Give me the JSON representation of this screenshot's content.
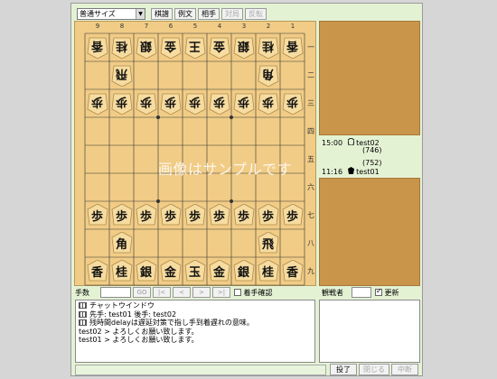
{
  "toolbar": {
    "size_select": "普通サイズ",
    "buttons": [
      {
        "label": "棋譜",
        "disabled": false
      },
      {
        "label": "例文",
        "disabled": false
      },
      {
        "label": "相手",
        "disabled": false
      },
      {
        "label": "対局",
        "disabled": true
      },
      {
        "label": "反転",
        "disabled": true
      }
    ]
  },
  "board": {
    "col_labels": [
      "9",
      "8",
      "7",
      "6",
      "5",
      "4",
      "3",
      "2",
      "1"
    ],
    "row_labels": [
      "一",
      "二",
      "三",
      "四",
      "五",
      "六",
      "七",
      "八",
      "九"
    ],
    "pieces": [
      {
        "r": 0,
        "c": 0,
        "k": "香",
        "gote": true
      },
      {
        "r": 0,
        "c": 1,
        "k": "桂",
        "gote": true
      },
      {
        "r": 0,
        "c": 2,
        "k": "銀",
        "gote": true
      },
      {
        "r": 0,
        "c": 3,
        "k": "金",
        "gote": true
      },
      {
        "r": 0,
        "c": 4,
        "k": "王",
        "gote": true
      },
      {
        "r": 0,
        "c": 5,
        "k": "金",
        "gote": true
      },
      {
        "r": 0,
        "c": 6,
        "k": "銀",
        "gote": true
      },
      {
        "r": 0,
        "c": 7,
        "k": "桂",
        "gote": true
      },
      {
        "r": 0,
        "c": 8,
        "k": "香",
        "gote": true
      },
      {
        "r": 1,
        "c": 1,
        "k": "飛",
        "gote": true
      },
      {
        "r": 1,
        "c": 7,
        "k": "角",
        "gote": true
      },
      {
        "r": 2,
        "c": 0,
        "k": "歩",
        "gote": true
      },
      {
        "r": 2,
        "c": 1,
        "k": "歩",
        "gote": true
      },
      {
        "r": 2,
        "c": 2,
        "k": "歩",
        "gote": true
      },
      {
        "r": 2,
        "c": 3,
        "k": "歩",
        "gote": true
      },
      {
        "r": 2,
        "c": 4,
        "k": "歩",
        "gote": true
      },
      {
        "r": 2,
        "c": 5,
        "k": "歩",
        "gote": true
      },
      {
        "r": 2,
        "c": 6,
        "k": "歩",
        "gote": true
      },
      {
        "r": 2,
        "c": 7,
        "k": "歩",
        "gote": true
      },
      {
        "r": 2,
        "c": 8,
        "k": "歩",
        "gote": true
      },
      {
        "r": 6,
        "c": 0,
        "k": "歩",
        "gote": false
      },
      {
        "r": 6,
        "c": 1,
        "k": "歩",
        "gote": false
      },
      {
        "r": 6,
        "c": 2,
        "k": "歩",
        "gote": false
      },
      {
        "r": 6,
        "c": 3,
        "k": "歩",
        "gote": false
      },
      {
        "r": 6,
        "c": 4,
        "k": "歩",
        "gote": false
      },
      {
        "r": 6,
        "c": 5,
        "k": "歩",
        "gote": false
      },
      {
        "r": 6,
        "c": 6,
        "k": "歩",
        "gote": false
      },
      {
        "r": 6,
        "c": 7,
        "k": "歩",
        "gote": false
      },
      {
        "r": 6,
        "c": 8,
        "k": "歩",
        "gote": false
      },
      {
        "r": 7,
        "c": 1,
        "k": "角",
        "gote": false
      },
      {
        "r": 7,
        "c": 7,
        "k": "飛",
        "gote": false
      },
      {
        "r": 8,
        "c": 0,
        "k": "香",
        "gote": false
      },
      {
        "r": 8,
        "c": 1,
        "k": "桂",
        "gote": false
      },
      {
        "r": 8,
        "c": 2,
        "k": "銀",
        "gote": false
      },
      {
        "r": 8,
        "c": 3,
        "k": "金",
        "gote": false
      },
      {
        "r": 8,
        "c": 4,
        "k": "玉",
        "gote": false
      },
      {
        "r": 8,
        "c": 5,
        "k": "金",
        "gote": false
      },
      {
        "r": 8,
        "c": 6,
        "k": "銀",
        "gote": false
      },
      {
        "r": 8,
        "c": 7,
        "k": "桂",
        "gote": false
      },
      {
        "r": 8,
        "c": 8,
        "k": "香",
        "gote": false
      }
    ],
    "watermark": "画像はサンプルです"
  },
  "players": {
    "gote": {
      "time": "15:00",
      "name": "test02",
      "rating": "(746)"
    },
    "sente": {
      "time": "11:16",
      "name": "test01",
      "rating": "(752)"
    }
  },
  "move_bar": {
    "label": "手数",
    "go": "GO",
    "nav": [
      "|<",
      "<",
      ">",
      ">|"
    ],
    "confirm_label": "着手確認"
  },
  "spectator_bar": {
    "label": "観戦者",
    "update_label": "更新"
  },
  "chat": {
    "lines": [
      {
        "icon": true,
        "text": "チャットウインドウ"
      },
      {
        "icon": true,
        "text": "先手: test01  後手: test02"
      },
      {
        "icon": true,
        "text": "残時間delayは遅延対策で指し手到着遅れの意味。"
      },
      {
        "icon": false,
        "text": "test02 > よろしくお願い致します。"
      },
      {
        "icon": false,
        "text": "test01 > よろしくお願い致します。"
      }
    ]
  },
  "bottom_buttons": [
    {
      "label": "投了",
      "disabled": false
    },
    {
      "label": "閉じる",
      "disabled": true
    },
    {
      "label": "中断",
      "disabled": true
    }
  ]
}
